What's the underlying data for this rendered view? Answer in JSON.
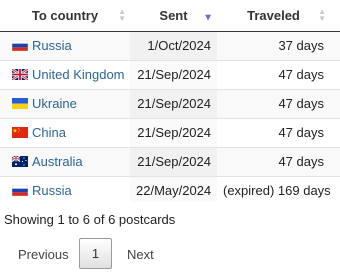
{
  "table": {
    "headers": {
      "country": "To country",
      "sent": "Sent",
      "traveled": "Traveled"
    },
    "rows": [
      {
        "flag": "russia-flag-icon",
        "country": "Russia",
        "sent": "1/Oct/2024",
        "traveled": "37 days"
      },
      {
        "flag": "uk-flag-icon",
        "country": "United Kingdom",
        "sent": "21/Sep/2024",
        "traveled": "47 days"
      },
      {
        "flag": "ukraine-flag-icon",
        "country": "Ukraine",
        "sent": "21/Sep/2024",
        "traveled": "47 days"
      },
      {
        "flag": "china-flag-icon",
        "country": "China",
        "sent": "21/Sep/2024",
        "traveled": "47 days"
      },
      {
        "flag": "australia-flag-icon",
        "country": "Australia",
        "sent": "21/Sep/2024",
        "traveled": "47 days"
      },
      {
        "flag": "russia-flag-icon",
        "country": "Russia",
        "sent": "22/May/2024",
        "traveled": "(expired) 169 days"
      }
    ]
  },
  "info": "Showing 1 to 6 of 6 postcards",
  "pagination": {
    "previous": "Previous",
    "current": "1",
    "next": "Next"
  },
  "colors": {
    "link": "#2c6694",
    "sort_active": "#6b6bd6",
    "sort_inactive": "#c8c8c8"
  }
}
